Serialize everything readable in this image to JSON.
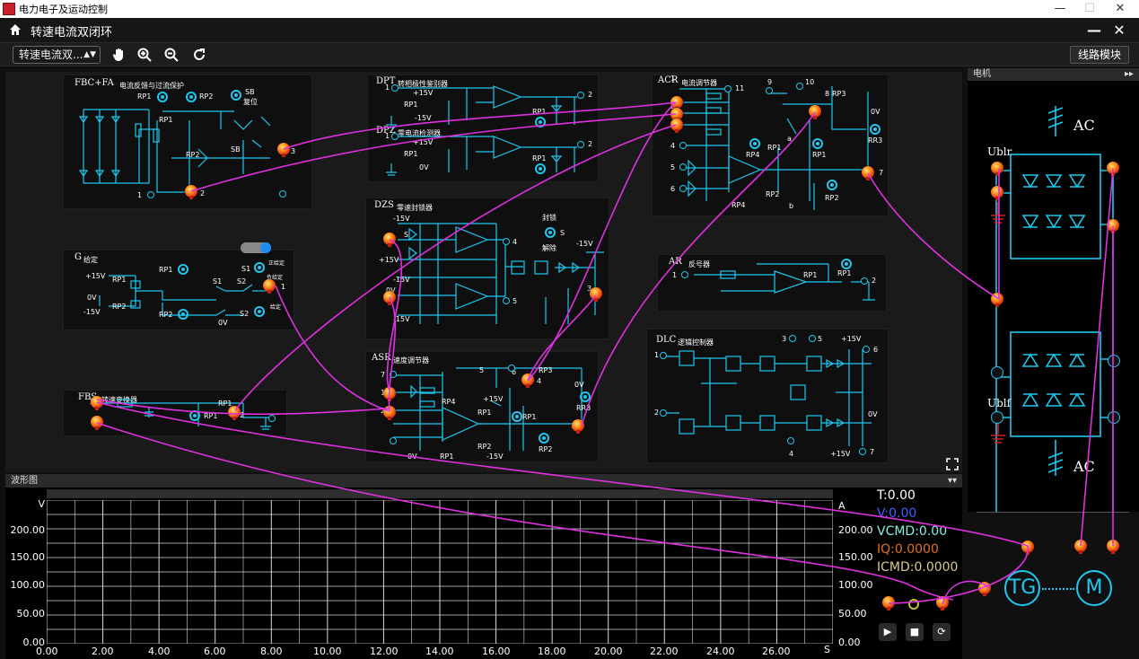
{
  "window": {
    "title": "电力电子及运动控制",
    "min": "—",
    "max": "☐",
    "close": "✕"
  },
  "header": {
    "title": "转速电流双闭环",
    "min_btn": "—",
    "close_btn": "✕"
  },
  "toolbar": {
    "mode_select": "转速电流双...",
    "module_button": "线路模块"
  },
  "panels": {
    "waveform": "波形图",
    "motor": "电机"
  },
  "modules": {
    "fbc": {
      "title": "FBC+FA",
      "sub": "电流反馈与过流保护",
      "rp1": "RP1",
      "rp2": "RP2",
      "sb": "SB",
      "sb2": "复位",
      "rp1b": "RP1",
      "rp2b": "RP2",
      "sbb": "SB",
      "n1": "1",
      "n2": "2",
      "n3": "3"
    },
    "dpt": {
      "title": "DPT",
      "sub": "转相极性鉴别器",
      "p15": "+15V",
      "m15": "-15V",
      "rp1": "RP1",
      "rp1b": "RP1",
      "n1": "1",
      "n2": "2"
    },
    "dpz": {
      "title": "DPZ",
      "sub": "零电流检测器",
      "p15": "+15V",
      "rp1": "RP1",
      "rp1b": "RP1",
      "v0": "0V",
      "n1": "1",
      "n2": "2"
    },
    "acr": {
      "title": "ACR",
      "sub": "电流调节器",
      "n1": "1",
      "n2": "2",
      "n3": "3",
      "n4": "4",
      "n5": "5",
      "n6": "6",
      "n7": "7",
      "n8": "8",
      "n9": "9",
      "n10": "10",
      "n11": "11",
      "rp3": "RP3",
      "v0": "0V",
      "rr3": "RR3",
      "rp1": "RP1",
      "rp4": "RP4",
      "rp1b": "RP1",
      "rp2": "RP2",
      "rp4b": "RP4",
      "rp2b": "RP2",
      "a": "a",
      "b": "b"
    },
    "dzs": {
      "title": "DZS",
      "sub": "零速封锁器",
      "m15": "-15V",
      "p15": "+15V",
      "v0": "0V",
      "m15b": "-15V",
      "m15c": "-15V",
      "m15d": "-15V",
      "lock": "封锁",
      "unlock": "解除",
      "s": "S",
      "s2": "S",
      "n1": "1",
      "n2": "2",
      "n3": "3",
      "n4": "4",
      "n5": "5"
    },
    "g": {
      "title": "G",
      "sub": "给定",
      "p15": "+15V",
      "rp1": "RP1",
      "rp1b": "RP1",
      "v0": "0V",
      "rp2": "RP2",
      "m15": "-15V",
      "rp2b": "RP2",
      "s1": "S1",
      "s2": "S2",
      "s1b": "S1",
      "s2b": "S2",
      "v0b": "0V",
      "pos": "正给定",
      "neg": "负给定",
      "zero": "给定",
      "n1": "1"
    },
    "ar": {
      "title": "AR",
      "sub": "反号器",
      "rp1": "RP1",
      "rp1b": "RP1",
      "n1": "1",
      "n2": "2"
    },
    "fbs": {
      "title": "FBS",
      "sub": "转速变换器",
      "rp1": "RP1",
      "rp1b": "RP1",
      "n1": "1",
      "n2": "2"
    },
    "asr": {
      "title": "ASR",
      "sub": "速度调节器",
      "n1": "1",
      "n2": "2",
      "n3": "3",
      "n4": "4",
      "n5": "5",
      "n6": "6",
      "n7": "7",
      "rp3": "RP3",
      "v0": "0V",
      "rr3": "RR3",
      "rp4": "RP4",
      "p15": "+15V",
      "rp1": "RP1",
      "rp1b": "RP1",
      "rp2": "RP2",
      "m15": "-15V",
      "rp1c": "RP1",
      "rp2b": "RP2",
      "v0b": "0V"
    },
    "dlc": {
      "title": "DLC",
      "sub": "逻辑控制器",
      "n1": "1",
      "n2": "2",
      "n3": "3",
      "n4": "4",
      "n5": "5",
      "n6": "6",
      "n7": "7",
      "p15": "+15V",
      "p15b": "+15V",
      "v0": "0V"
    }
  },
  "waveform": {
    "y_left_unit": "V",
    "y_right_unit": "A",
    "x_unit": "S",
    "y_left_ticks": [
      "200.00",
      "150.00",
      "100.00",
      "50.00",
      "0.00"
    ],
    "y_right_ticks": [
      "200.00",
      "150.00",
      "100.00",
      "50.00",
      "0.00"
    ],
    "x_ticks": [
      "0.00",
      "2.00",
      "4.00",
      "6.00",
      "8.00",
      "10.00",
      "12.00",
      "14.00",
      "16.00",
      "18.00",
      "20.00",
      "22.00",
      "24.00",
      "26.00"
    ],
    "readouts": {
      "t": "T:0.00",
      "v": "V:0.00",
      "vcmd": "VCMD:0.00",
      "iq": "IQ:0.0000",
      "icmd": "ICMD:0.0000"
    },
    "readout_colors": {
      "t": "#ffffff",
      "v": "#4060ff",
      "vcmd": "#7ff0e0",
      "iq": "#e07020",
      "icmd": "#d8c890"
    }
  },
  "motor_panel": {
    "ac_top": "AC",
    "ac_bottom": "AC",
    "ublr": "Ublr",
    "ublf": "Ublf",
    "tg": "TG",
    "m": "M"
  },
  "colors": {
    "wire": "#e030e0",
    "circuit": "#1ec8f0",
    "background": "#101010"
  }
}
